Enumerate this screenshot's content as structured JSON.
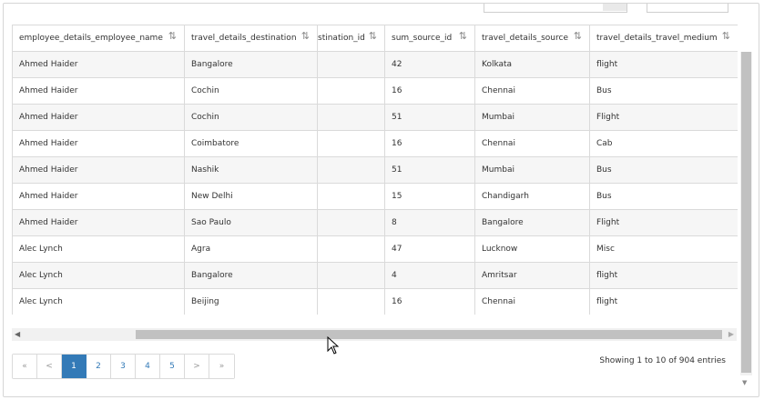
{
  "columns": [
    {
      "label": "employee_details_employee_name",
      "sort": "⇅"
    },
    {
      "label": "travel_details_destination",
      "sort": "⇅"
    },
    {
      "label": "stination_id",
      "sort": "⇅"
    },
    {
      "label": "sum_source_id",
      "sort": "⇅"
    },
    {
      "label": "travel_details_source",
      "sort": "⇅"
    },
    {
      "label": "travel_details_travel_medium",
      "sort": "⇅"
    }
  ],
  "rows": [
    {
      "name": "Ahmed Haider",
      "destination": "Bangalore",
      "dest_id": "",
      "sum_source_id": "42",
      "source": "Kolkata",
      "medium": "flight"
    },
    {
      "name": "Ahmed Haider",
      "destination": "Cochin",
      "dest_id": "",
      "sum_source_id": "16",
      "source": "Chennai",
      "medium": "Bus"
    },
    {
      "name": "Ahmed Haider",
      "destination": "Cochin",
      "dest_id": "",
      "sum_source_id": "51",
      "source": "Mumbai",
      "medium": "Flight"
    },
    {
      "name": "Ahmed Haider",
      "destination": "Coimbatore",
      "dest_id": "",
      "sum_source_id": "16",
      "source": "Chennai",
      "medium": "Cab"
    },
    {
      "name": "Ahmed Haider",
      "destination": "Nashik",
      "dest_id": "",
      "sum_source_id": "51",
      "source": "Mumbai",
      "medium": "Bus"
    },
    {
      "name": "Ahmed Haider",
      "destination": "New Delhi",
      "dest_id": "",
      "sum_source_id": "15",
      "source": "Chandigarh",
      "medium": "Bus"
    },
    {
      "name": "Ahmed Haider",
      "destination": "Sao Paulo",
      "dest_id": "",
      "sum_source_id": "8",
      "source": "Bangalore",
      "medium": "Flight"
    },
    {
      "name": "Alec Lynch",
      "destination": "Agra",
      "dest_id": "",
      "sum_source_id": "47",
      "source": "Lucknow",
      "medium": "Misc"
    },
    {
      "name": "Alec Lynch",
      "destination": "Bangalore",
      "dest_id": "",
      "sum_source_id": "4",
      "source": "Amritsar",
      "medium": "flight"
    },
    {
      "name": "Alec Lynch",
      "destination": "Beijing",
      "dest_id": "",
      "sum_source_id": "16",
      "source": "Chennai",
      "medium": "flight"
    }
  ],
  "pagination": {
    "first": "«",
    "prev": "<",
    "pages": [
      "1",
      "2",
      "3",
      "4",
      "5"
    ],
    "active_page": "1",
    "next": ">",
    "last": "»"
  },
  "info": "Showing 1 to 10 of 904 entries",
  "icons": {
    "scroll_left": "scroll-left-arrow-icon",
    "scroll_right": "scroll-right-arrow-icon",
    "scroll_down": "scroll-down-arrow-icon",
    "cursor": "mouse-pointer-icon"
  },
  "colors": {
    "accent": "#337ab7",
    "stripe": "#f6f6f6",
    "border": "#dadada"
  }
}
